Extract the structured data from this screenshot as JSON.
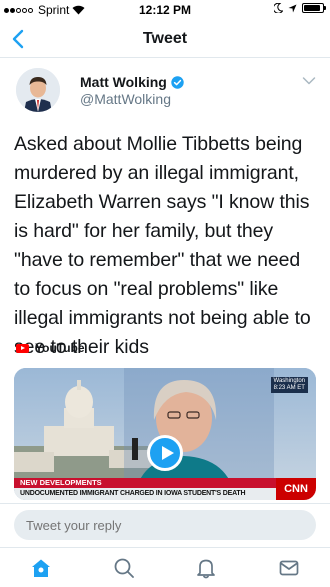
{
  "status_bar": {
    "carrier": "Sprint",
    "time": "12:12 PM",
    "battery_level": 0.9
  },
  "nav": {
    "title": "Tweet",
    "back_icon": "chevron-left-icon"
  },
  "tweet": {
    "author_name": "Matt Wolking",
    "author_handle": "@MattWolking",
    "verified": true,
    "text": "Asked about Mollie Tibbetts being murdered by an illegal immigrant, Elizabeth Warren says \"I know this is hard\" for her family, but they \"have to remember\" that we need to focus on \"real problems\" like illegal immigrants not being able to see to their kids",
    "source_label": "YouTube",
    "video": {
      "location_line1": "Washington",
      "location_line2": "8:23 AM ET",
      "band_text": "NEW DEVELOPMENTS",
      "headline_text": "UNDOCUMENTED IMMIGRANT CHARGED IN IOWA STUDENT'S DEATH",
      "network_logo": "CNN"
    }
  },
  "reply": {
    "placeholder": "Tweet your reply"
  },
  "tabbar": {
    "items": [
      "home-icon",
      "search-icon",
      "notifications-icon",
      "messages-icon"
    ],
    "accent_color": "#1da1f2",
    "inactive_color": "#657786"
  }
}
